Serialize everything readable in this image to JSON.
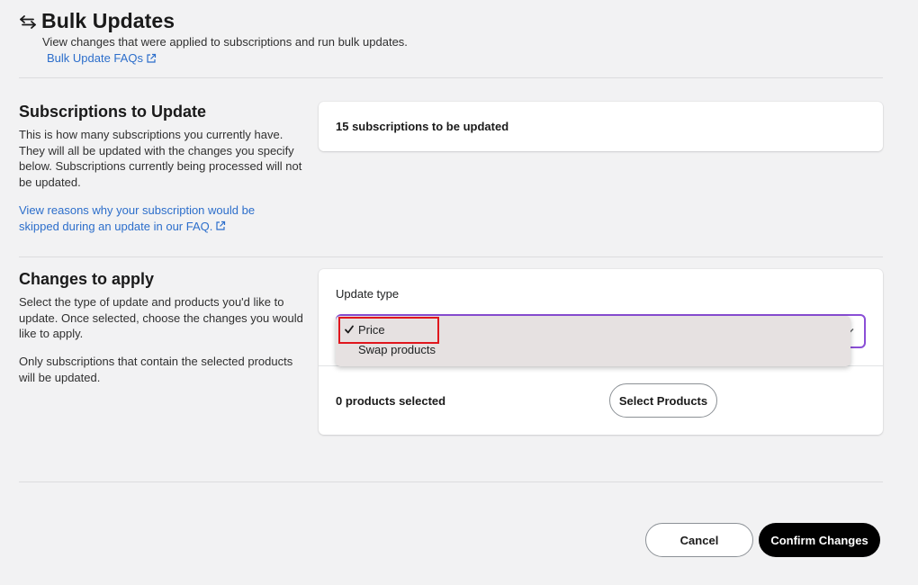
{
  "header": {
    "title": "Bulk Updates",
    "subtitle": "View changes that were applied to subscriptions and run bulk updates.",
    "faq_link": "Bulk Update FAQs"
  },
  "subscriptions_section": {
    "title": "Subscriptions to Update",
    "description": "This is how many subscriptions you currently have. They will all be updated with the changes you specify below. Subscriptions currently being processed will not be updated.",
    "link": "View reasons why your subscription would be skipped during an update in our FAQ.",
    "count_text": "15 subscriptions to be updated"
  },
  "changes_section": {
    "title": "Changes to apply",
    "description_1": "Select the type of update and products you'd like to update. Once selected, choose the changes you would like to apply.",
    "description_2": "Only subscriptions that contain the selected products will be updated.",
    "update_type_label": "Update type",
    "selected_value": "Price",
    "options": [
      "Price",
      "Swap products"
    ],
    "products_selected": "0 products selected",
    "select_products_label": "Select Products"
  },
  "footer": {
    "cancel_label": "Cancel",
    "confirm_label": "Confirm Changes"
  },
  "colors": {
    "link": "#2c6ecb",
    "focus_ring": "#8a4fd6",
    "highlight": "#e0161d",
    "primary_button": "#000000"
  },
  "icons": {
    "back": "arrows-left-right-icon",
    "external": "external-link-icon",
    "check": "checkmark-icon",
    "chevron": "chevron-down-icon"
  }
}
